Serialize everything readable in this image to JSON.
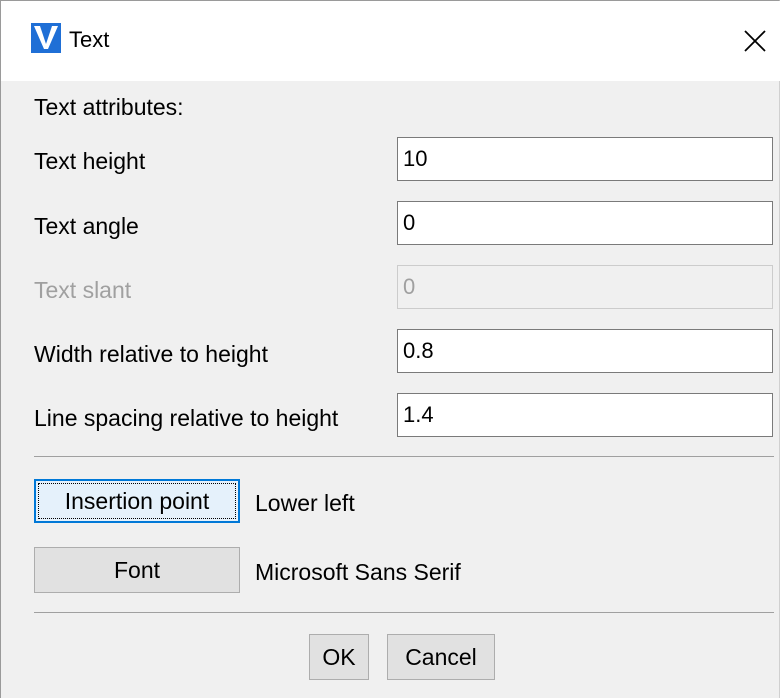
{
  "window": {
    "title": "Text",
    "icon": "vectorcad-logo-icon",
    "close_icon": "close-x-icon"
  },
  "section_label": "Text attributes:",
  "fields": {
    "text_height": {
      "label": "Text height",
      "value": "10"
    },
    "text_angle": {
      "label": "Text angle",
      "value": "0"
    },
    "text_slant": {
      "label": "Text slant",
      "value": "0",
      "disabled": true
    },
    "width_relative": {
      "label": "Width relative to height",
      "value": "0.8"
    },
    "line_spacing": {
      "label": "Line spacing relative to height",
      "value": "1.4"
    }
  },
  "insertion": {
    "button_label": "Insertion point",
    "value": "Lower left"
  },
  "font": {
    "button_label": "Font",
    "value": "Microsoft Sans Serif"
  },
  "footer": {
    "ok_label": "OK",
    "cancel_label": "Cancel"
  },
  "colors": {
    "focus_accent": "#0078d7",
    "logo_blue": "#1f6fd6",
    "dialog_bg": "#f0f0f0"
  }
}
